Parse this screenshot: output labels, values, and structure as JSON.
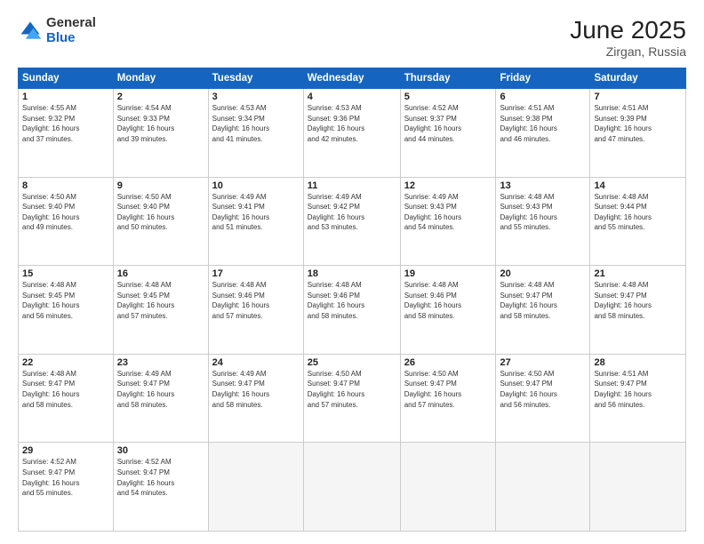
{
  "logo": {
    "general": "General",
    "blue": "Blue"
  },
  "title": {
    "month": "June 2025",
    "location": "Zirgan, Russia"
  },
  "header_days": [
    "Sunday",
    "Monday",
    "Tuesday",
    "Wednesday",
    "Thursday",
    "Friday",
    "Saturday"
  ],
  "weeks": [
    [
      {
        "day": "1",
        "info": "Sunrise: 4:55 AM\nSunset: 9:32 PM\nDaylight: 16 hours\nand 37 minutes."
      },
      {
        "day": "2",
        "info": "Sunrise: 4:54 AM\nSunset: 9:33 PM\nDaylight: 16 hours\nand 39 minutes."
      },
      {
        "day": "3",
        "info": "Sunrise: 4:53 AM\nSunset: 9:34 PM\nDaylight: 16 hours\nand 41 minutes."
      },
      {
        "day": "4",
        "info": "Sunrise: 4:53 AM\nSunset: 9:36 PM\nDaylight: 16 hours\nand 42 minutes."
      },
      {
        "day": "5",
        "info": "Sunrise: 4:52 AM\nSunset: 9:37 PM\nDaylight: 16 hours\nand 44 minutes."
      },
      {
        "day": "6",
        "info": "Sunrise: 4:51 AM\nSunset: 9:38 PM\nDaylight: 16 hours\nand 46 minutes."
      },
      {
        "day": "7",
        "info": "Sunrise: 4:51 AM\nSunset: 9:39 PM\nDaylight: 16 hours\nand 47 minutes."
      }
    ],
    [
      {
        "day": "8",
        "info": "Sunrise: 4:50 AM\nSunset: 9:40 PM\nDaylight: 16 hours\nand 49 minutes."
      },
      {
        "day": "9",
        "info": "Sunrise: 4:50 AM\nSunset: 9:40 PM\nDaylight: 16 hours\nand 50 minutes."
      },
      {
        "day": "10",
        "info": "Sunrise: 4:49 AM\nSunset: 9:41 PM\nDaylight: 16 hours\nand 51 minutes."
      },
      {
        "day": "11",
        "info": "Sunrise: 4:49 AM\nSunset: 9:42 PM\nDaylight: 16 hours\nand 53 minutes."
      },
      {
        "day": "12",
        "info": "Sunrise: 4:49 AM\nSunset: 9:43 PM\nDaylight: 16 hours\nand 54 minutes."
      },
      {
        "day": "13",
        "info": "Sunrise: 4:48 AM\nSunset: 9:43 PM\nDaylight: 16 hours\nand 55 minutes."
      },
      {
        "day": "14",
        "info": "Sunrise: 4:48 AM\nSunset: 9:44 PM\nDaylight: 16 hours\nand 55 minutes."
      }
    ],
    [
      {
        "day": "15",
        "info": "Sunrise: 4:48 AM\nSunset: 9:45 PM\nDaylight: 16 hours\nand 56 minutes."
      },
      {
        "day": "16",
        "info": "Sunrise: 4:48 AM\nSunset: 9:45 PM\nDaylight: 16 hours\nand 57 minutes."
      },
      {
        "day": "17",
        "info": "Sunrise: 4:48 AM\nSunset: 9:46 PM\nDaylight: 16 hours\nand 57 minutes."
      },
      {
        "day": "18",
        "info": "Sunrise: 4:48 AM\nSunset: 9:46 PM\nDaylight: 16 hours\nand 58 minutes."
      },
      {
        "day": "19",
        "info": "Sunrise: 4:48 AM\nSunset: 9:46 PM\nDaylight: 16 hours\nand 58 minutes."
      },
      {
        "day": "20",
        "info": "Sunrise: 4:48 AM\nSunset: 9:47 PM\nDaylight: 16 hours\nand 58 minutes."
      },
      {
        "day": "21",
        "info": "Sunrise: 4:48 AM\nSunset: 9:47 PM\nDaylight: 16 hours\nand 58 minutes."
      }
    ],
    [
      {
        "day": "22",
        "info": "Sunrise: 4:48 AM\nSunset: 9:47 PM\nDaylight: 16 hours\nand 58 minutes."
      },
      {
        "day": "23",
        "info": "Sunrise: 4:49 AM\nSunset: 9:47 PM\nDaylight: 16 hours\nand 58 minutes."
      },
      {
        "day": "24",
        "info": "Sunrise: 4:49 AM\nSunset: 9:47 PM\nDaylight: 16 hours\nand 58 minutes."
      },
      {
        "day": "25",
        "info": "Sunrise: 4:50 AM\nSunset: 9:47 PM\nDaylight: 16 hours\nand 57 minutes."
      },
      {
        "day": "26",
        "info": "Sunrise: 4:50 AM\nSunset: 9:47 PM\nDaylight: 16 hours\nand 57 minutes."
      },
      {
        "day": "27",
        "info": "Sunrise: 4:50 AM\nSunset: 9:47 PM\nDaylight: 16 hours\nand 56 minutes."
      },
      {
        "day": "28",
        "info": "Sunrise: 4:51 AM\nSunset: 9:47 PM\nDaylight: 16 hours\nand 56 minutes."
      }
    ],
    [
      {
        "day": "29",
        "info": "Sunrise: 4:52 AM\nSunset: 9:47 PM\nDaylight: 16 hours\nand 55 minutes."
      },
      {
        "day": "30",
        "info": "Sunrise: 4:52 AM\nSunset: 9:47 PM\nDaylight: 16 hours\nand 54 minutes."
      },
      {
        "day": "",
        "info": ""
      },
      {
        "day": "",
        "info": ""
      },
      {
        "day": "",
        "info": ""
      },
      {
        "day": "",
        "info": ""
      },
      {
        "day": "",
        "info": ""
      }
    ]
  ]
}
